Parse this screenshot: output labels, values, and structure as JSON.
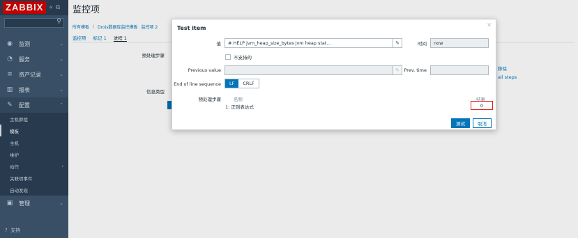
{
  "app": {
    "logo": "ZABBIX",
    "collapse_icon": "«",
    "kiosk_icon": "⧉",
    "search_icon": "⚲"
  },
  "sidebar": {
    "items": [
      {
        "label": "监测",
        "icon": "eye-icon",
        "glyph": "◉"
      },
      {
        "label": "服务",
        "icon": "clock-icon",
        "glyph": "◔"
      },
      {
        "label": "资产记录",
        "icon": "list-icon",
        "glyph": "≡"
      },
      {
        "label": "报表",
        "icon": "chart-icon",
        "glyph": "▥"
      },
      {
        "label": "配置",
        "icon": "wrench-icon",
        "glyph": "🔧"
      }
    ],
    "sub_items": [
      {
        "label": "主机群组"
      },
      {
        "label": "模板"
      },
      {
        "label": "主机"
      },
      {
        "label": "维护"
      },
      {
        "label": "动作"
      },
      {
        "label": "关联项事件"
      },
      {
        "label": "自动发现"
      }
    ],
    "admin": {
      "label": "管理",
      "glyph": "▣"
    },
    "support": {
      "label": "支持",
      "glyph": "?"
    }
  },
  "page": {
    "title": "监控项",
    "breadcrumb": [
      "所有模板",
      "Drois数据库监控模板",
      "监控项 2"
    ],
    "tabs": [
      "监控项",
      "标记 1",
      "进程 1"
    ],
    "bg_labels": {
      "steps": "预处理步骤",
      "info_type": "信息类型"
    },
    "bg_links": {
      "remove": "移除",
      "all_steps": "ail steps"
    }
  },
  "dialog": {
    "title": "Test item",
    "close": "×",
    "value_label": "值",
    "value": "# HELP  jvm_heap_size_bytes jvm heap stat...",
    "time_label": "时间",
    "time_value": "now",
    "not_supported_label": "不支持的",
    "prev_value_label": "Previous value",
    "prev_value": "",
    "prev_time_label": "Prev. time",
    "prev_time": "",
    "eol_label": "End of line sequence",
    "eol_options": [
      "LF",
      "CRLF"
    ],
    "eol_selected": "LF",
    "steps_label": "预处理步骤",
    "col_name": "名称",
    "col_result": "结果",
    "step_name": "1: 正则表达式",
    "step_result": "0",
    "test_button": "测试",
    "cancel_button": "取消"
  },
  "colors": {
    "sidebar": "#3e566f",
    "accent": "#0275b8",
    "logo": "#d40000",
    "highlight": "#e0201c"
  }
}
